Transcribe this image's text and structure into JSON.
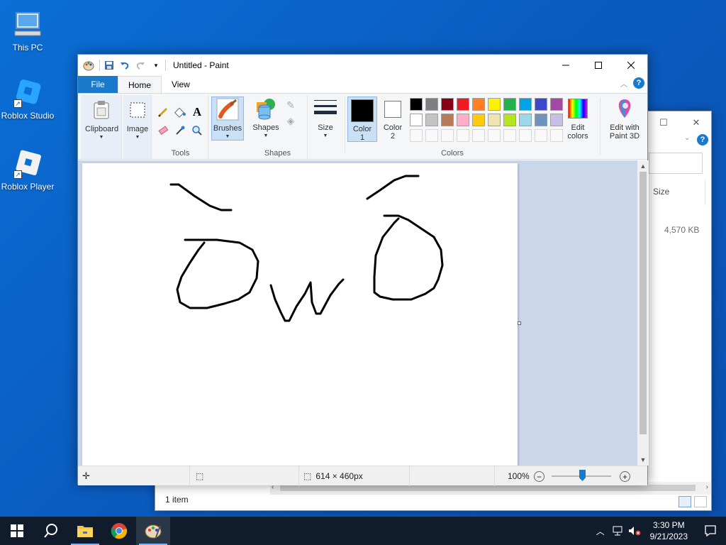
{
  "desktop": {
    "icons": [
      {
        "label": "This PC"
      },
      {
        "label": "Roblox Studio"
      },
      {
        "label": "Roblox Player"
      }
    ]
  },
  "explorer": {
    "column_size": "Size",
    "file_size": "4,570 KB",
    "status": "1 item"
  },
  "paint": {
    "title": "Untitled - Paint",
    "tabs": {
      "file": "File",
      "home": "Home",
      "view": "View"
    },
    "ribbon": {
      "clipboard": "Clipboard",
      "image": "Image",
      "tools_group": "Tools",
      "brushes": "Brushes",
      "shapes": "Shapes",
      "shapes_group": "Shapes",
      "size": "Size",
      "color1_line1": "Color",
      "color1_line2": "1",
      "color2_line1": "Color",
      "color2_line2": "2",
      "edit_colors_line1": "Edit",
      "edit_colors_line2": "colors",
      "edit_paint3d_line1": "Edit with",
      "edit_paint3d_line2": "Paint 3D",
      "colors_group": "Colors"
    },
    "palette_row1": [
      "#000000",
      "#7f7f7f",
      "#880015",
      "#ed1c24",
      "#ff7f27",
      "#fff200",
      "#22b14c",
      "#00a2e8",
      "#3f48cc",
      "#a349a4"
    ],
    "palette_row2": [
      "#ffffff",
      "#c3c3c3",
      "#b97a57",
      "#ffaec9",
      "#ffc90e",
      "#efe4b0",
      "#b5e61d",
      "#99d9ea",
      "#7092be",
      "#c8bfe7"
    ],
    "color1": "#000000",
    "color2": "#ffffff",
    "status": {
      "canvas_size": "614 × 460px",
      "zoom": "100%",
      "zoom_level": 1.0
    }
  },
  "taskbar": {
    "time": "3:30 PM",
    "date": "9/21/2023"
  }
}
